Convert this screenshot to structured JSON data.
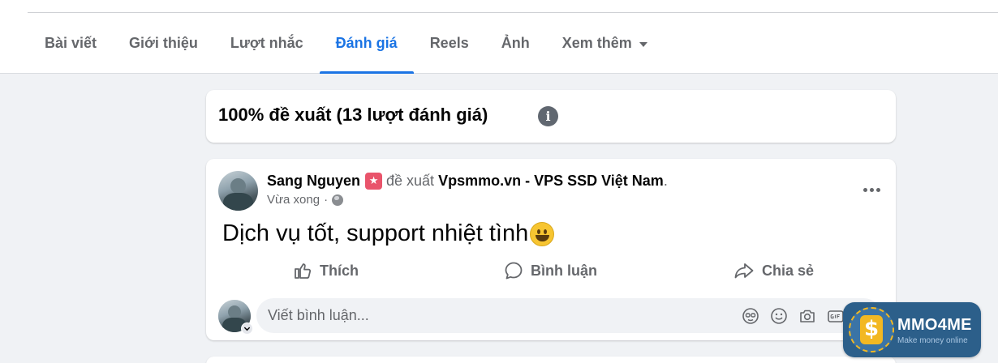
{
  "tabs": [
    {
      "label": "Bài viết",
      "active": false
    },
    {
      "label": "Giới thiệu",
      "active": false
    },
    {
      "label": "Lượt nhắc",
      "active": false
    },
    {
      "label": "Đánh giá",
      "active": true
    },
    {
      "label": "Reels",
      "active": false
    },
    {
      "label": "Ảnh",
      "active": false
    },
    {
      "label": "Xem thêm",
      "active": false,
      "dropdown": true
    }
  ],
  "summary": {
    "text": "100% đề xuất (13 lượt đánh giá)",
    "info_icon": "info-icon"
  },
  "review": {
    "author": "Sang Nguyen",
    "verb": "đề xuất",
    "page": "Vpsmmo.vn - VPS SSD Việt Nam",
    "trailing": ".",
    "time": "Vừa xong",
    "separator": "·",
    "privacy_icon": "globe-icon",
    "body": "Dịch vụ tốt, support nhiệt tình",
    "emoji": "smiling-face-icon",
    "actions": {
      "like": "Thích",
      "comment": "Bình luận",
      "share": "Chia sẻ"
    },
    "comment_placeholder": "Viết bình luận..."
  },
  "watermark": {
    "title": "MMO4ME",
    "subtitle": "Make money online"
  },
  "colors": {
    "accent": "#1b74e4",
    "page_bg": "#f0f2f5",
    "secondary_text": "#65676b",
    "recommend_badge": "#e9546b",
    "watermark_bg": "#2c5f8a"
  }
}
